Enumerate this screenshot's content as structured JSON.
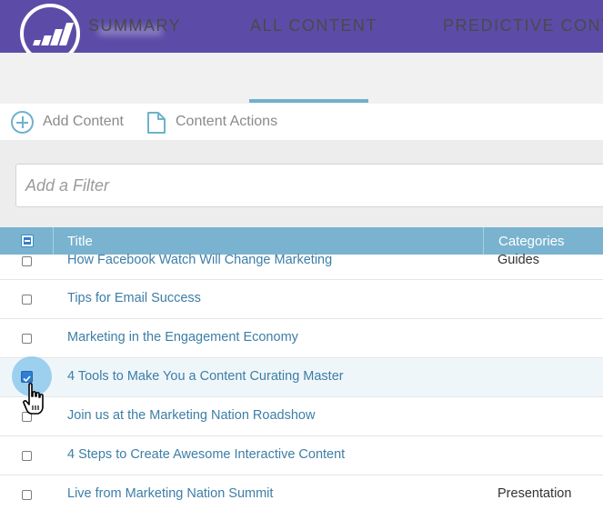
{
  "header": {
    "logo": "marketo-logo-icon",
    "workspace_name": "xxxxxxxxxx",
    "brand_color": "#5c4ca8"
  },
  "tabs": [
    {
      "label": "SUMMARY",
      "active": false
    },
    {
      "label": "ALL CONTENT",
      "active": true
    },
    {
      "label": "PREDICTIVE CONTE",
      "active": false
    }
  ],
  "toolbar": {
    "add_content_label": "Add Content",
    "add_content_icon": "plus-circle-icon",
    "content_actions_label": "Content Actions",
    "content_actions_icon": "document-icon"
  },
  "filter": {
    "placeholder": "Add a Filter"
  },
  "table": {
    "columns": [
      "Title",
      "Categories"
    ],
    "header_color": "#79b3cf",
    "link_color": "#3d7ea6",
    "rows": [
      {
        "title": "How Facebook Watch Will Change Marketing",
        "category": "Guides",
        "checked": false
      },
      {
        "title": "Tips for Email Success",
        "category": "",
        "checked": false
      },
      {
        "title": "Marketing in the Engagement Economy",
        "category": "",
        "checked": false
      },
      {
        "title": "4 Tools to Make You a Content Curating Master",
        "category": "",
        "checked": true
      },
      {
        "title": "Join us at the Marketing Nation Roadshow",
        "category": "",
        "checked": false
      },
      {
        "title": "4 Steps to Create Awesome Interactive Content",
        "category": "",
        "checked": false
      },
      {
        "title": "Live from Marketing Nation Summit",
        "category": "Presentation",
        "checked": false
      }
    ]
  },
  "cursor": "hand-pointer-icon"
}
